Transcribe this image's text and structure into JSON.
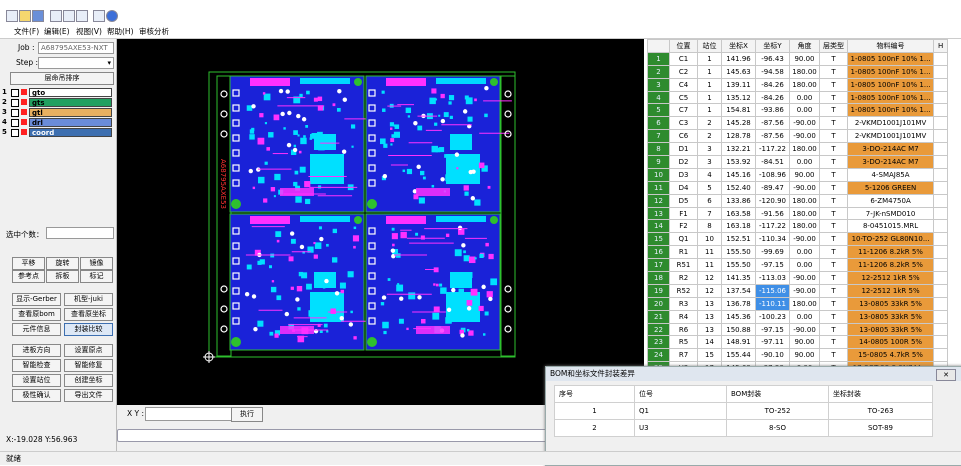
{
  "menu": [
    "文件(F)",
    "编辑(E)",
    "视图(V)",
    "帮助(H)",
    "审核分析"
  ],
  "left": {
    "job_label": "Job :",
    "job_value": "A68795AXE53-NXT",
    "step_label": "Step :",
    "step_value": "",
    "layer_sort_button": "层命吊排序",
    "layers": [
      {
        "num": "1",
        "name": "gto",
        "color": "#ffffff",
        "swatch": "#ff2020"
      },
      {
        "num": "2",
        "name": "gts",
        "color": "#22a060",
        "swatch": "#ff2020"
      },
      {
        "num": "3",
        "name": "gtl",
        "color": "#e8b060",
        "swatch": "#ff2020"
      },
      {
        "num": "4",
        "name": "drl",
        "color": "#6a8cd8",
        "swatch": "#ff2020"
      },
      {
        "num": "5",
        "name": "coord",
        "color": "#3d6fb0",
        "swatch": "#ff2020"
      }
    ],
    "selected_label": "选中个数：",
    "buttons": [
      [
        "平移",
        "旋转",
        "镜像"
      ],
      [
        "参考点",
        "拆板",
        "标记"
      ],
      [
        "显示-Gerber",
        "机型-juki"
      ],
      [
        "查看原bom",
        "查看原坐标"
      ],
      [
        "元件信息",
        "封装比较"
      ],
      [
        "进板方向",
        "设置原点"
      ],
      [
        "智能检查",
        "智能修复"
      ],
      [
        "设置站位",
        "创建坐标"
      ],
      [
        "极性确认",
        "导出文件"
      ]
    ]
  },
  "bottom": {
    "xy_label": "X Y :",
    "xy_value": "",
    "exec_button": "执行"
  },
  "status": {
    "coords": "X:-19.028  Y:56.963",
    "ready": "就绪"
  },
  "canvas": {
    "board_text": "A68795AXE53"
  },
  "bom_table": {
    "headers": [
      "",
      "位置",
      "站位",
      "坐标X",
      "坐标Y",
      "角度",
      "层类型",
      "物料编号",
      "H"
    ],
    "rows": [
      [
        "1",
        "C1",
        "1",
        "141.96",
        "-96.43",
        "90.00",
        "T",
        "1-0805 100nF 10% 1..."
      ],
      [
        "2",
        "C2",
        "1",
        "145.63",
        "-94.58",
        "180.00",
        "T",
        "1-0805 100nF 10% 1..."
      ],
      [
        "3",
        "C4",
        "1",
        "139.11",
        "-84.26",
        "180.00",
        "T",
        "1-0805 100nF 10% 1..."
      ],
      [
        "4",
        "C5",
        "1",
        "135.12",
        "-84.26",
        "0.00",
        "T",
        "1-0805 100nF 10% 1..."
      ],
      [
        "5",
        "C7",
        "1",
        "154.81",
        "-93.86",
        "0.00",
        "T",
        "1-0805 100nF 10% 1..."
      ],
      [
        "6",
        "C3",
        "2",
        "145.28",
        "-87.56",
        "-90.00",
        "T",
        "2-VKMD1001J101MV"
      ],
      [
        "7",
        "C6",
        "2",
        "128.78",
        "-87.56",
        "-90.00",
        "T",
        "2-VKMD1001J101MV"
      ],
      [
        "8",
        "D1",
        "3",
        "132.21",
        "-117.22",
        "180.00",
        "T",
        "3-DO-214AC M7"
      ],
      [
        "9",
        "D2",
        "3",
        "153.92",
        "-84.51",
        "0.00",
        "T",
        "3-DO-214AC M7"
      ],
      [
        "10",
        "D3",
        "4",
        "145.16",
        "-108.96",
        "90.00",
        "T",
        "4-SMAJ85A"
      ],
      [
        "11",
        "D4",
        "5",
        "152.40",
        "-89.47",
        "-90.00",
        "T",
        "5-1206 GREEN"
      ],
      [
        "12",
        "D5",
        "6",
        "133.86",
        "-120.90",
        "180.00",
        "T",
        "6-ZM4750A"
      ],
      [
        "13",
        "F1",
        "7",
        "163.58",
        "-91.56",
        "180.00",
        "T",
        "7-JK-nSMD010"
      ],
      [
        "14",
        "F2",
        "8",
        "163.18",
        "-117.22",
        "180.00",
        "T",
        "8-0451015.MRL"
      ],
      [
        "15",
        "Q1",
        "10",
        "152.51",
        "-110.34",
        "-90.00",
        "T",
        "10-TO-252 GL80N10..."
      ],
      [
        "16",
        "R1",
        "11",
        "155.50",
        "-99.69",
        "0.00",
        "T",
        "11-1206 8.2kR 5%"
      ],
      [
        "17",
        "R51",
        "11",
        "155.50",
        "-97.15",
        "0.00",
        "T",
        "11-1206 8.2kR 5%"
      ],
      [
        "18",
        "R2",
        "12",
        "141.35",
        "-113.03",
        "-90.00",
        "T",
        "12-2512 1kR 5%"
      ],
      [
        "19",
        "R52",
        "12",
        "137.54",
        "-115.06",
        "-90.00",
        "T",
        "12-2512 1kR 5%"
      ],
      [
        "20",
        "R3",
        "13",
        "136.78",
        "-110.11",
        "180.00",
        "T",
        "13-0805 33kR 5%"
      ],
      [
        "21",
        "R4",
        "13",
        "145.36",
        "-100.23",
        "0.00",
        "T",
        "13-0805 33kR 5%"
      ],
      [
        "22",
        "R6",
        "13",
        "150.88",
        "-97.15",
        "-90.00",
        "T",
        "13-0805 33kR 5%"
      ],
      [
        "23",
        "R5",
        "14",
        "148.91",
        "-97.11",
        "90.00",
        "T",
        "14-0805 100R 5%"
      ],
      [
        "24",
        "R7",
        "15",
        "155.44",
        "-90.10",
        "90.00",
        "T",
        "15-0805 4.7kR 5%"
      ],
      [
        "25",
        "U2",
        "17",
        "145.68",
        "-97.38",
        "0.00",
        "T",
        "17-SOT-23-5 SN74A..."
      ],
      [
        "26",
        "U3",
        "18",
        "136.65",
        "-88.43",
        "-90.00",
        "T",
        "18-SOT-89 SE8650K2..."
      ]
    ],
    "orange_rows": [
      1,
      2,
      3,
      4,
      5,
      8,
      9,
      11,
      15,
      16,
      17,
      18,
      19,
      20,
      21,
      22,
      23,
      24,
      25,
      26
    ],
    "highlight_cells": [
      [
        19,
        4
      ],
      [
        20,
        4
      ]
    ]
  },
  "dialog": {
    "title": "BOM和坐标文件封装差异",
    "close_label": "✕",
    "headers": [
      "序号",
      "位号",
      "BOM封装",
      "坐标封装"
    ],
    "rows": [
      [
        "1",
        "Q1",
        "TO-252",
        "TO-263"
      ],
      [
        "2",
        "U3",
        "8-SO",
        "SOT-89"
      ]
    ]
  }
}
